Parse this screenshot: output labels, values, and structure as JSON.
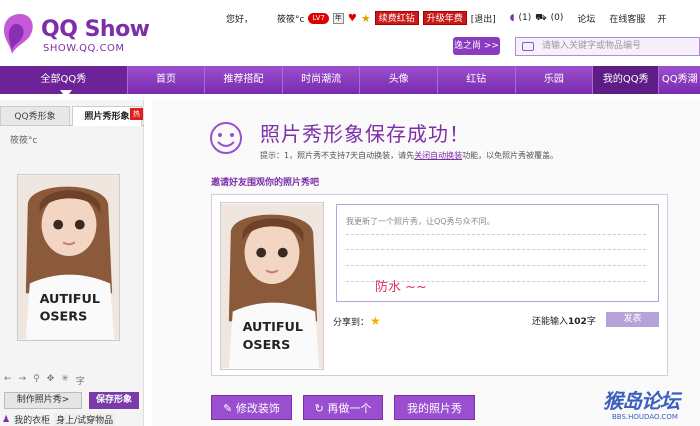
{
  "logo": {
    "title": "QQ Show",
    "sub": "SHOW.QQ.COM"
  },
  "topbar": {
    "greeting": "您好，",
    "username": "筱筱°c",
    "level_badge": "LV7",
    "icon_year": "年",
    "renew_red": "续费红钻",
    "upgrade_year": "升级年费",
    "logout": "[退出]",
    "msg_count": "(1)",
    "cart_count": "(0)",
    "forum": "论坛",
    "service": "在线客服",
    "last": "开"
  },
  "share_pill": "逸之尚 >>",
  "search": {
    "placeholder": "请输入关键字或物品编号"
  },
  "nav": {
    "items": [
      "全部QQ秀",
      "首页",
      "推荐搭配",
      "时尚潮流",
      "头像",
      "红钻",
      "乐园",
      "我的QQ秀",
      "QQ秀潮"
    ]
  },
  "left": {
    "tab1": "QQ秀形象",
    "tab2": "照片秀形象",
    "hot": "热",
    "uname": "筱筱°c",
    "tools": [
      "←",
      "→",
      "⚲",
      "✥",
      "✳",
      "字"
    ],
    "make_btn": "制作照片秀>",
    "save_btn": "保存形象",
    "bottom1": "我的衣柜",
    "bottom2": "身上/试穿物品"
  },
  "main": {
    "success_title": "照片秀形象保存成功！",
    "tip_prefix": "提示：1，照片秀不支持7天自动换装，请先",
    "tip_link": "关闭自动换装",
    "tip_suffix": "功能，以免照片秀被覆盖。",
    "invite": "邀请好友围观你的照片秀吧",
    "placeholder": "我更新了一个照片秀，让QQ秀与众不同。",
    "typed": "防水 ~~",
    "share": "分享到：",
    "remain_prefix": "还能输入",
    "remain_num": "102",
    "remain_suffix": "字",
    "publish": "发表",
    "btn_edit": "修改装饰",
    "btn_again": "再做一个",
    "btn_mine": "我的照片秀"
  },
  "watermark": {
    "main": "猴岛论坛",
    "sub": "BBS.HOUDAO.COM"
  },
  "colors": {
    "brand": "#7d2fa7",
    "nav": "#8a3bbf",
    "red": "#c91a1a"
  }
}
